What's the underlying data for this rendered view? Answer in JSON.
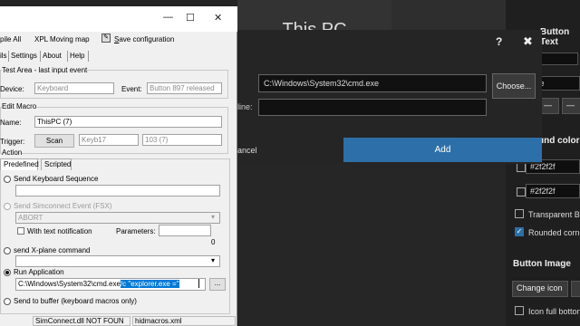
{
  "background": {
    "tile_title": "This PC"
  },
  "right_panel": {
    "button_text_header": "Button Text",
    "font_value": "ite",
    "background_color_header": "round color",
    "color1": "#2f2f2f",
    "color2": "#2f2f2f",
    "transparent_label": "Transparent Ba",
    "rounded_label": "Rounded corne",
    "button_image_header": "Button Image",
    "change_icon_label": "Change icon",
    "icon_full_label": "Icon full botton"
  },
  "dialog": {
    "help_icon": "?",
    "close_icon": "✖",
    "path_value": "C:\\Windows\\System32\\cmd.exe",
    "choose_label": "Choose...",
    "line_label": "line:",
    "cancel_label": "ancel",
    "add_label": "Add"
  },
  "app": {
    "window_controls": {
      "minimize": "—",
      "maximize": "☐",
      "close": "✕"
    },
    "toolbar": {
      "compile_all": "pile All",
      "xpl_moving_map": "XPL Moving map",
      "save_configuration": "Save configuration",
      "save_prefix": "S",
      "save_rest": "ave configuration"
    },
    "menu": [
      "ils",
      "Settings",
      "About",
      "Help"
    ],
    "test_area": {
      "title": "Test Area - last input event",
      "device_label": "Device:",
      "device_value": "Keyboard",
      "event_label": "Event:",
      "event_value": "Button 897 released"
    },
    "edit_macro": {
      "title": "Edit Macro",
      "name_label": "Name:",
      "name_value": "ThisPC (7)",
      "trigger_label": "Trigger:",
      "scan_label": "Scan",
      "trigger_value1": "Keyb17",
      "trigger_value2": "103  (7)"
    },
    "action": {
      "title": "Action",
      "tabs": [
        "Predefined",
        "Scripted"
      ],
      "send_keyboard_label": "Send Keyboard Sequence",
      "send_simconnect_label": "Send Simconnect Event (FSX)",
      "simconnect_value": "ABORT",
      "with_text_label": "With text notification",
      "parameters_label": "Parameters:",
      "send_xplane_label": "send X-plane command",
      "xplane_value": "0",
      "run_app_label": "Run Application",
      "run_app_path": "C:\\Windows\\System32\\cmd.exe",
      "run_app_args": "/c \"explorer.exe =\"",
      "browse_label": "...",
      "send_buffer_label": "Send to buffer (keyboard macros only)"
    },
    "status": {
      "simconnect": "SimConnect.dll NOT FOUN",
      "file": "hidmacros.xml"
    }
  }
}
